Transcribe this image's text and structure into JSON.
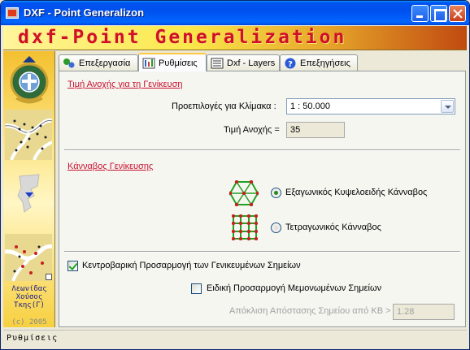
{
  "window": {
    "title": "DXF - Point Generalizon"
  },
  "banner": {
    "text": "dxf-Point Generalization"
  },
  "left_panel": {
    "author_name": "Λεωνίδας",
    "author_surname": "Χούσος",
    "author_dept": "Τκης(Γ)",
    "year": "(c) 2005"
  },
  "tabs": [
    {
      "label": "Επεξεργασία",
      "icon": "process-icon"
    },
    {
      "label": "Ρυθμίσεις",
      "icon": "settings-icon",
      "active": true
    },
    {
      "label": "Dxf - Layers",
      "icon": "layers-icon"
    },
    {
      "label": "Επεξηγήσεις",
      "icon": "help-icon"
    }
  ],
  "tolerance": {
    "section_title": "Τιμή Ανοχής για τη Γενίκευση",
    "scale_label": "Προεπιλογές για Κλίμακα :",
    "scale_value": "1 : 50.000",
    "tolerance_label": "Τιμή Ανοχής =",
    "tolerance_value": "35"
  },
  "grid": {
    "section_title": "Κάνναβος Γενίκευσης",
    "hex_label": "Εξαγωνικός Κυψελοειδής Κάνναβος",
    "square_label": "Τετραγωνικός Κάνναβος",
    "selected": "hex"
  },
  "options": {
    "centroid_label": "Κεντροβαρική Προσαρμογή των Γενικευμένων Σημείων",
    "centroid_checked": true,
    "isolated_label": "Ειδική Προσαρμογή Μεμονωμένων Σημείων",
    "isolated_checked": false,
    "deviation_label": "Απόκλιση Απόστασης Σημείου από ΚΒ >",
    "deviation_value": "1.28"
  },
  "status": {
    "text": "Ρυθμίσεις"
  },
  "colors": {
    "accent_red": "#c8102e",
    "title_blue": "#0054e3",
    "grid_green": "#21a121"
  }
}
